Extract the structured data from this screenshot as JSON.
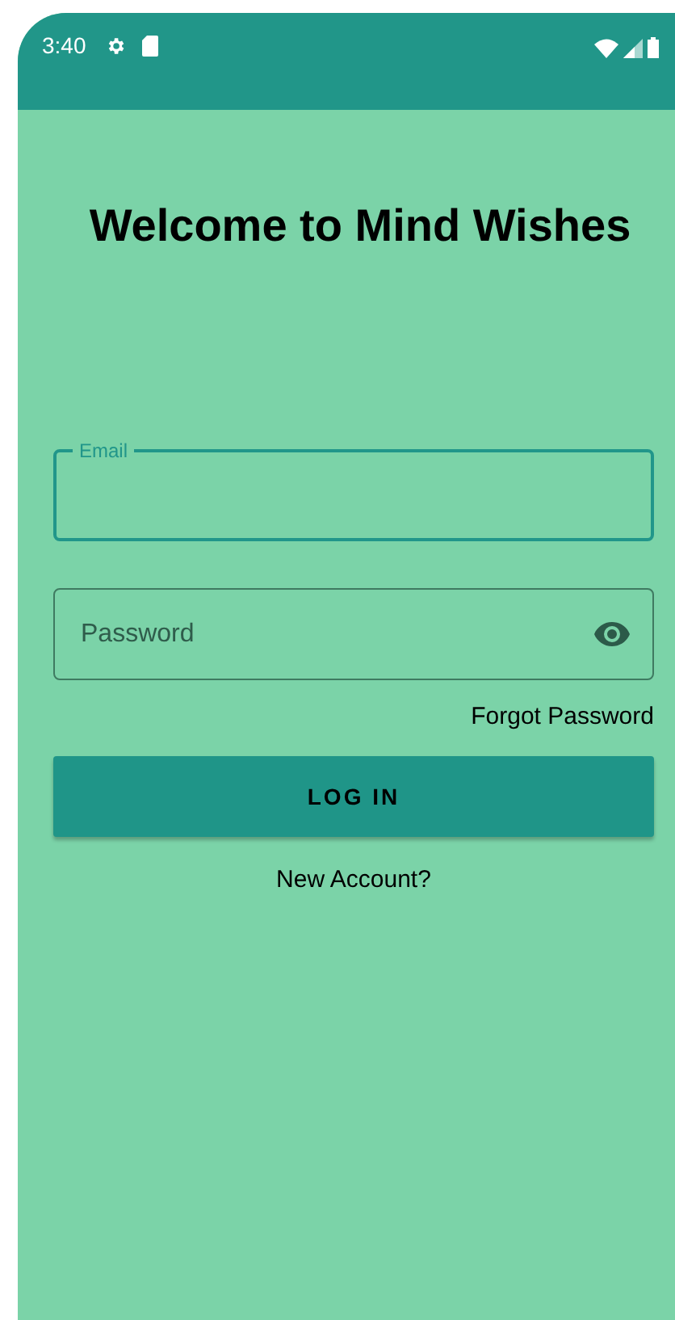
{
  "status_bar": {
    "time": "3:40"
  },
  "title": "Welcome to Mind Wishes",
  "email_field": {
    "label": "Email",
    "focused": true
  },
  "password_field": {
    "placeholder": "Password",
    "focused": false
  },
  "forgot_password": "Forgot Password",
  "login_button": "LOG IN",
  "new_account": "New Account?"
}
